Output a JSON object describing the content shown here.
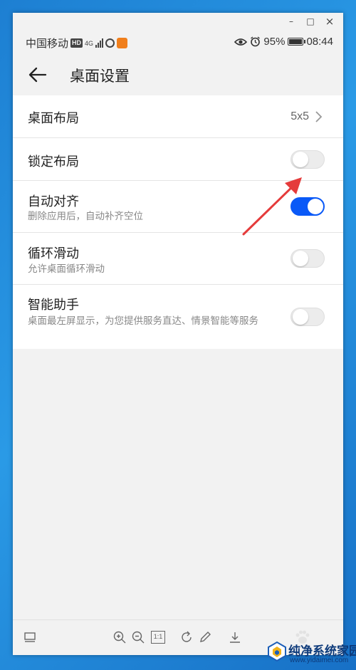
{
  "window": {
    "minimize_glyph": "–",
    "maximize_glyph": "□",
    "close_glyph": "×"
  },
  "status_bar": {
    "carrier": "中国移动",
    "hd_badge": "HD",
    "network": "4G",
    "battery_percent": "95%",
    "battery_level": 0.95,
    "time": "08:44",
    "icons": [
      "hd-icon",
      "signal-icon",
      "globe-icon",
      "app-notification-icon",
      "eye-icon",
      "alarm-icon",
      "battery-icon"
    ]
  },
  "header": {
    "title": "桌面设置",
    "back_icon": "arrow-left-icon"
  },
  "settings": {
    "items": [
      {
        "label": "桌面布局",
        "value": "5x5"
      },
      {
        "label": "锁定布局",
        "enabled": false
      },
      {
        "label": "自动对齐",
        "subtitle": "删除应用后，自动补齐空位",
        "enabled": true
      },
      {
        "label": "循环滑动",
        "subtitle": "允许桌面循环滑动",
        "enabled": false
      },
      {
        "label": "智能助手",
        "subtitle": "桌面最左屏显示，为您提供服务直达、情景智能等服务",
        "enabled": false
      }
    ]
  },
  "toolbar": {
    "icons": [
      "layout-icon",
      "zoom-in-icon",
      "zoom-out-icon",
      "actual-size-icon",
      "rotate-icon",
      "edit-icon",
      "download-icon",
      "paw-icon"
    ],
    "actual_size_label": "1:1"
  },
  "watermark": {
    "title": "纯净系统家园",
    "url": "www.yidaimei.com"
  },
  "colors": {
    "toggle_on": "#0a59f7",
    "annotation_arrow": "#e53b3b",
    "desktop_blue": "#1d7fd2"
  }
}
